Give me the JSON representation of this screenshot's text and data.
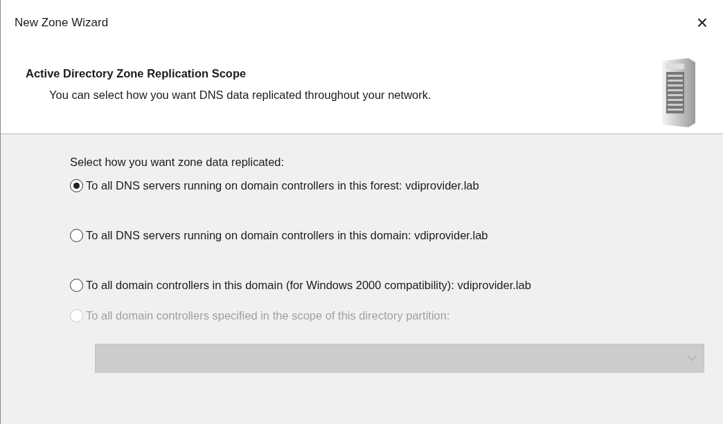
{
  "window": {
    "title": "New Zone Wizard",
    "close": "×"
  },
  "header": {
    "title": "Active Directory Zone Replication Scope",
    "subtitle": "You can select how you want DNS data replicated throughout your network."
  },
  "prompt": "Select how you want zone data replicated:",
  "options": [
    {
      "label": "To all DNS servers running on domain controllers in this forest: vdiprovider.lab",
      "selected": true,
      "disabled": false
    },
    {
      "label": "To all DNS servers running on domain controllers in this domain: vdiprovider.lab",
      "selected": false,
      "disabled": false
    },
    {
      "label": "To all domain controllers in this domain (for Windows 2000 compatibility): vdiprovider.lab",
      "selected": false,
      "disabled": false
    },
    {
      "label": "To all domain controllers specified in the scope of this directory partition:",
      "selected": false,
      "disabled": true
    }
  ],
  "partition_dropdown": {
    "disabled": true
  }
}
